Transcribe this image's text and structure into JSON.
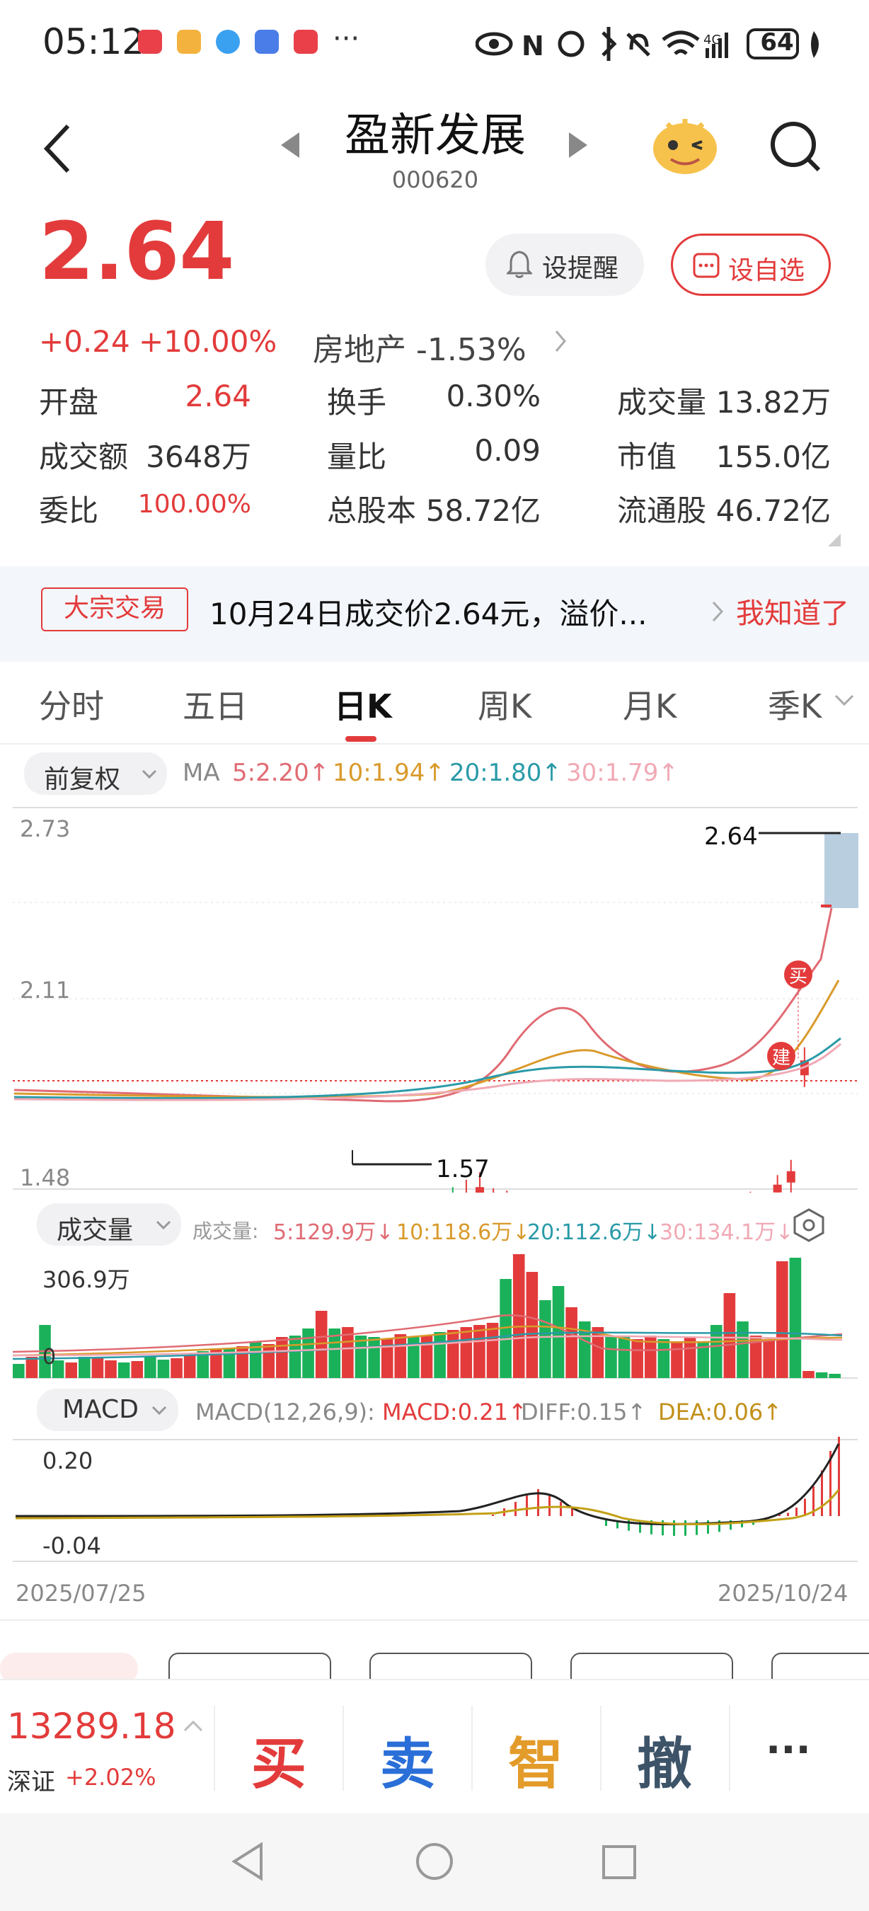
{
  "status": {
    "time": "05:12",
    "battery": "64",
    "network": "4G"
  },
  "header": {
    "title": "盈新发展",
    "code": "000620"
  },
  "quote": {
    "price": "2.64",
    "change": "+0.24",
    "change_pct": "+10.00%",
    "sector": "房地产 -1.53%",
    "alert_button": "设提醒",
    "watch_button": "设自选"
  },
  "stats": [
    {
      "label": "开盘",
      "value": "2.64"
    },
    {
      "label": "换手",
      "value": "0.30%"
    },
    {
      "label": "成交量",
      "value": "13.82万"
    },
    {
      "label": "成交额",
      "value": "3648万"
    },
    {
      "label": "量比",
      "value": "0.09"
    },
    {
      "label": "市值",
      "value": "155.0亿"
    },
    {
      "label": "委比",
      "value": "100.00%"
    },
    {
      "label": "总股本",
      "value": "58.72亿"
    },
    {
      "label": "流通股",
      "value": "46.72亿"
    }
  ],
  "notice": {
    "tag": "大宗交易",
    "text": "10月24日成交价2.64元，溢价...",
    "action": "我知道了"
  },
  "tabs": [
    "分时",
    "五日",
    "日K",
    "周K",
    "月K",
    "季K"
  ],
  "ma_bar": {
    "adjust": "前复权",
    "ma": "MA",
    "ma5": "5:2.20↑",
    "ma10": "10:1.94↑",
    "ma20": "20:1.80↑",
    "ma30": "30:1.79↑"
  },
  "kline": {
    "y_top": "2.73",
    "y_mid": "2.11",
    "y_bot": "1.48",
    "high_label": "2.64",
    "low_label": "1.57",
    "buy_marker": "买",
    "build_marker": "建"
  },
  "volume_bar": {
    "title": "成交量",
    "label": "成交量:",
    "v5": "5:129.9万↓",
    "v10": "10:118.6万↓",
    "v20": "20:112.6万↓",
    "v30": "30:134.1万↓",
    "max": "306.9万",
    "zero": "0"
  },
  "macd_bar": {
    "title": "MACD",
    "params": "MACD(12,26,9):",
    "macd": "MACD:0.21↑",
    "diff": "DIFF:0.15↑",
    "dea": "DEA:0.06↑",
    "y_top": "0.20",
    "y_bot": "-0.04"
  },
  "dates": {
    "start": "2025/07/25",
    "end": "2025/10/24"
  },
  "index": {
    "value": "13289.18",
    "name": "深证",
    "change": "+2.02%"
  },
  "actions": {
    "buy": "买",
    "sell": "卖",
    "smart": "智",
    "cancel": "撤",
    "more": "···"
  },
  "colors": {
    "up": "#e33b3b",
    "down": "#1bb15a",
    "ma5": "#e06b73",
    "ma10": "#d99a2b",
    "ma20": "#2a9aa8",
    "ma30": "#f0a9b5"
  }
}
